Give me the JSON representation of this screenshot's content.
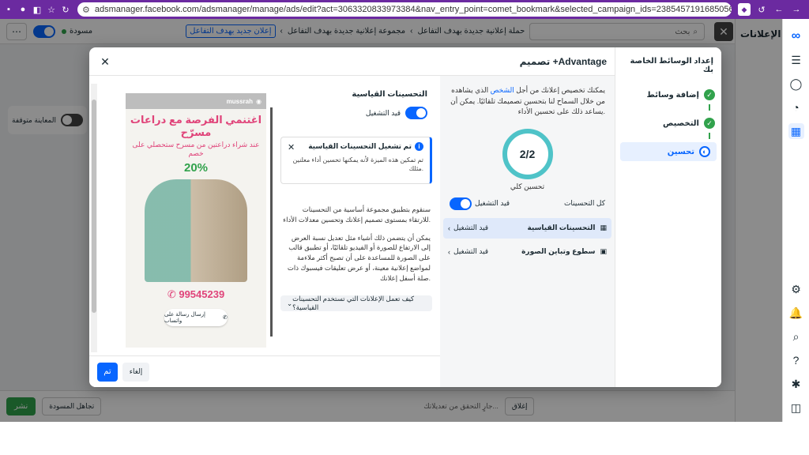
{
  "browser": {
    "url": "adsmanager.facebook.com/adsmanager/manage/ads/edit?act=306332083397338​4&nav_entry_point=comet_bookmark&selected_campaign_ids=23854571916850568&selected_ad_ids=23854571..."
  },
  "app": {
    "draft_label": "مسودة",
    "breadcrumb_campaign": "حملة إعلانية جديدة بهدف التفاعل",
    "breadcrumb_adset": "مجموعة إعلانية جديدة بهدف التفاعل",
    "breadcrumb_ad": "إعلان جديد بهدف التفاعل",
    "search_placeholder": "بحث",
    "right_title": "الإعلانات",
    "preview_toggle_label": "المعاينة متوقفة",
    "publish_label": "نشر",
    "discard_label": "تجاهل المسودة",
    "close_label": "إغلاق",
    "verifying_label": "جارٍ التحقق من تعديلاتك..."
  },
  "modal": {
    "title": "تصميم +Advantage",
    "steps_title": "إعداد الوسائط الخاصة بك",
    "steps": [
      {
        "label": "إضافة وسائط",
        "state": "done"
      },
      {
        "label": "التخصيص",
        "state": "done"
      },
      {
        "label": "تحسين",
        "state": "current"
      }
    ],
    "pane": {
      "desc_before": "يمكنك تخصيص إعلانك من أجل ",
      "desc_highlight": "الشخص",
      "desc_after": " الذي يشاهده من خلال السماح لنا بتحسين تصميمك تلقائيًا. يمكن أن يساعد ذلك على تحسين الأداء.",
      "score": "2/2",
      "score_label": "تحسين كلي",
      "all_label": "كل التحسينات",
      "all_state": "قيد التشغيل",
      "features": [
        {
          "label": "التحسينات القياسية",
          "state": "قيد التشغيل",
          "icon": "grid-icon"
        },
        {
          "label": "سطوع وتباين الصورة",
          "state": "قيد التشغيل",
          "icon": "image-icon"
        }
      ]
    },
    "center": {
      "title": "التحسينات القياسية",
      "state": "قيد التشغيل",
      "info_title": "تم تشغيل التحسينات القياسية",
      "info_body": "تم تمكين هذه الميزة لأنه يمكنها تحسين أداء معلنين مثلك.",
      "body1": "سنقوم بتطبيق مجموعة أساسية من التحسينات للارتقاء بمستوى تصميم إعلانك وتحسين معدلات الأداء.",
      "body2": "يمكن أن يتضمن ذلك أشياء مثل تعديل نسبة العرض إلى الارتفاع للصورة أو الفيديو تلقائيًا، أو تطبيق قالب على الصورة للمساعدة على أن تصبح أكثر ملاءمة لمواضع إعلانية معينة، أو عرض تعليقات فيسبوك ذات صلة أسفل إعلانك.",
      "faq": "كيف تعمل الإعلانات التي تستخدم التحسينات القياسية؟"
    },
    "preview": {
      "brand": "mussrah",
      "headline": "اغتنمي الفرصة مع دراعات مسرّح",
      "subline": "عند شراء دراعتين من مسرح ستحصلي على خصم",
      "discount": "20%",
      "phone": "99545239",
      "cta": "إرسال رسالة على واتساب"
    },
    "footer": {
      "done": "تم",
      "cancel": "إلغاء"
    }
  },
  "colors": {
    "accent": "#0866ff",
    "success": "#31a24c",
    "ring": "#4fc3c8",
    "ad_pink": "#e0447a"
  }
}
